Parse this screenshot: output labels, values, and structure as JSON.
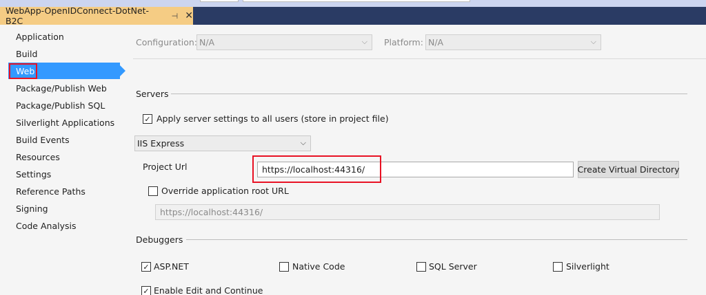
{
  "tab": {
    "title": "WebApp-OpenIDConnect-DotNet-B2C",
    "pin_icon": "pin-icon",
    "close_icon": "close-icon"
  },
  "sidebar": {
    "items": [
      {
        "label": "Application"
      },
      {
        "label": "Build"
      },
      {
        "label": "Web"
      },
      {
        "label": "Package/Publish Web"
      },
      {
        "label": "Package/Publish SQL"
      },
      {
        "label": "Silverlight Applications"
      },
      {
        "label": "Build Events"
      },
      {
        "label": "Resources"
      },
      {
        "label": "Settings"
      },
      {
        "label": "Reference Paths"
      },
      {
        "label": "Signing"
      },
      {
        "label": "Code Analysis"
      }
    ],
    "selected": "Web"
  },
  "config": {
    "configuration_label": "Configuration:",
    "configuration_value": "N/A",
    "platform_label": "Platform:",
    "platform_value": "N/A"
  },
  "servers": {
    "section_label": "Servers",
    "apply_all_label": "Apply server settings to all users (store in project file)",
    "apply_all_checked": true,
    "server_value": "IIS Express",
    "project_url_label": "Project Url",
    "project_url_value": "https://localhost:44316/",
    "create_vdir_label": "Create Virtual Directory",
    "override_label": "Override application root URL",
    "override_checked": false,
    "override_value": "https://localhost:44316/"
  },
  "debuggers": {
    "section_label": "Debuggers",
    "items": [
      {
        "label": "ASP.NET",
        "checked": true
      },
      {
        "label": "Native Code",
        "checked": false
      },
      {
        "label": "SQL Server",
        "checked": false
      },
      {
        "label": "Silverlight",
        "checked": false
      }
    ],
    "edit_continue_label": "Enable Edit and Continue",
    "edit_continue_checked": true
  },
  "colors": {
    "accent": "#3399ff",
    "highlight_red": "#e81123",
    "tab_gold": "#f5cc84",
    "tabbar_navy": "#2a3b64"
  }
}
